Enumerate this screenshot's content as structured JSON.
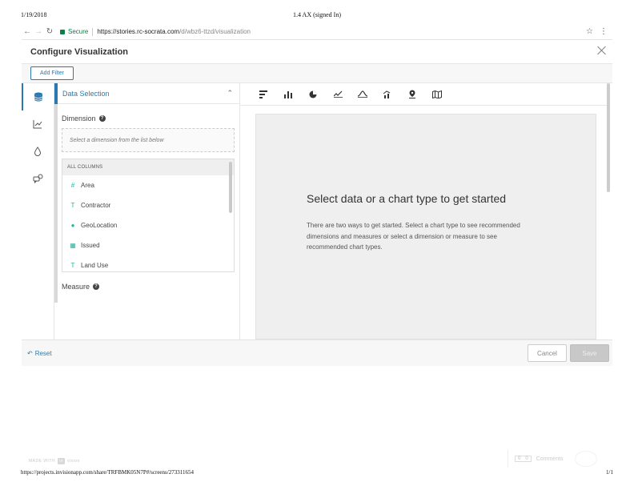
{
  "print": {
    "date": "1/19/2018",
    "title": "1.4 AX (signed In)",
    "footer_url": "https://projects.invisionapp.com/share/TRFBMK05N7P#/screens/273311654",
    "page": "1/1"
  },
  "browser": {
    "secure_label": "Secure",
    "url_host": "https://stories.rc-socrata.com",
    "url_path": "/d/wbz6-ttzd/visualization"
  },
  "app": {
    "title": "Configure Visualization",
    "add_filter_label": "Add Filter"
  },
  "left_panel": {
    "section_title": "Data Selection",
    "dimension_label": "Dimension",
    "dimension_placeholder": "Select a dimension from the list below",
    "columns_header": "ALL COLUMNS",
    "columns": [
      {
        "icon": "number-icon",
        "glyph": "#",
        "label": "Area"
      },
      {
        "icon": "text-icon",
        "glyph": "T",
        "label": "Contractor"
      },
      {
        "icon": "location-pin-icon",
        "glyph": "●",
        "label": "GeoLocation"
      },
      {
        "icon": "calendar-icon",
        "glyph": "▦",
        "label": "Issued"
      },
      {
        "icon": "text-icon",
        "glyph": "T",
        "label": "Land Use"
      }
    ],
    "measure_label": "Measure"
  },
  "main": {
    "empty_title": "Select data or a chart type to get started",
    "empty_body": "There are two ways to get started. Select a chart type to see recommended dimensions and measures or select a dimension or measure to see recommended chart types."
  },
  "footer_bar": {
    "reset_label": "Reset",
    "cancel_label": "Cancel",
    "save_label": "Save"
  },
  "invision": {
    "made_with": "MADE WITH",
    "logo": "in",
    "logo_rest": "vision",
    "comments_label": "Comments",
    "count_a": "0",
    "count_b": "0"
  },
  "colors": {
    "accent": "#2a7ab0",
    "column_icon": "#2cb29f"
  }
}
